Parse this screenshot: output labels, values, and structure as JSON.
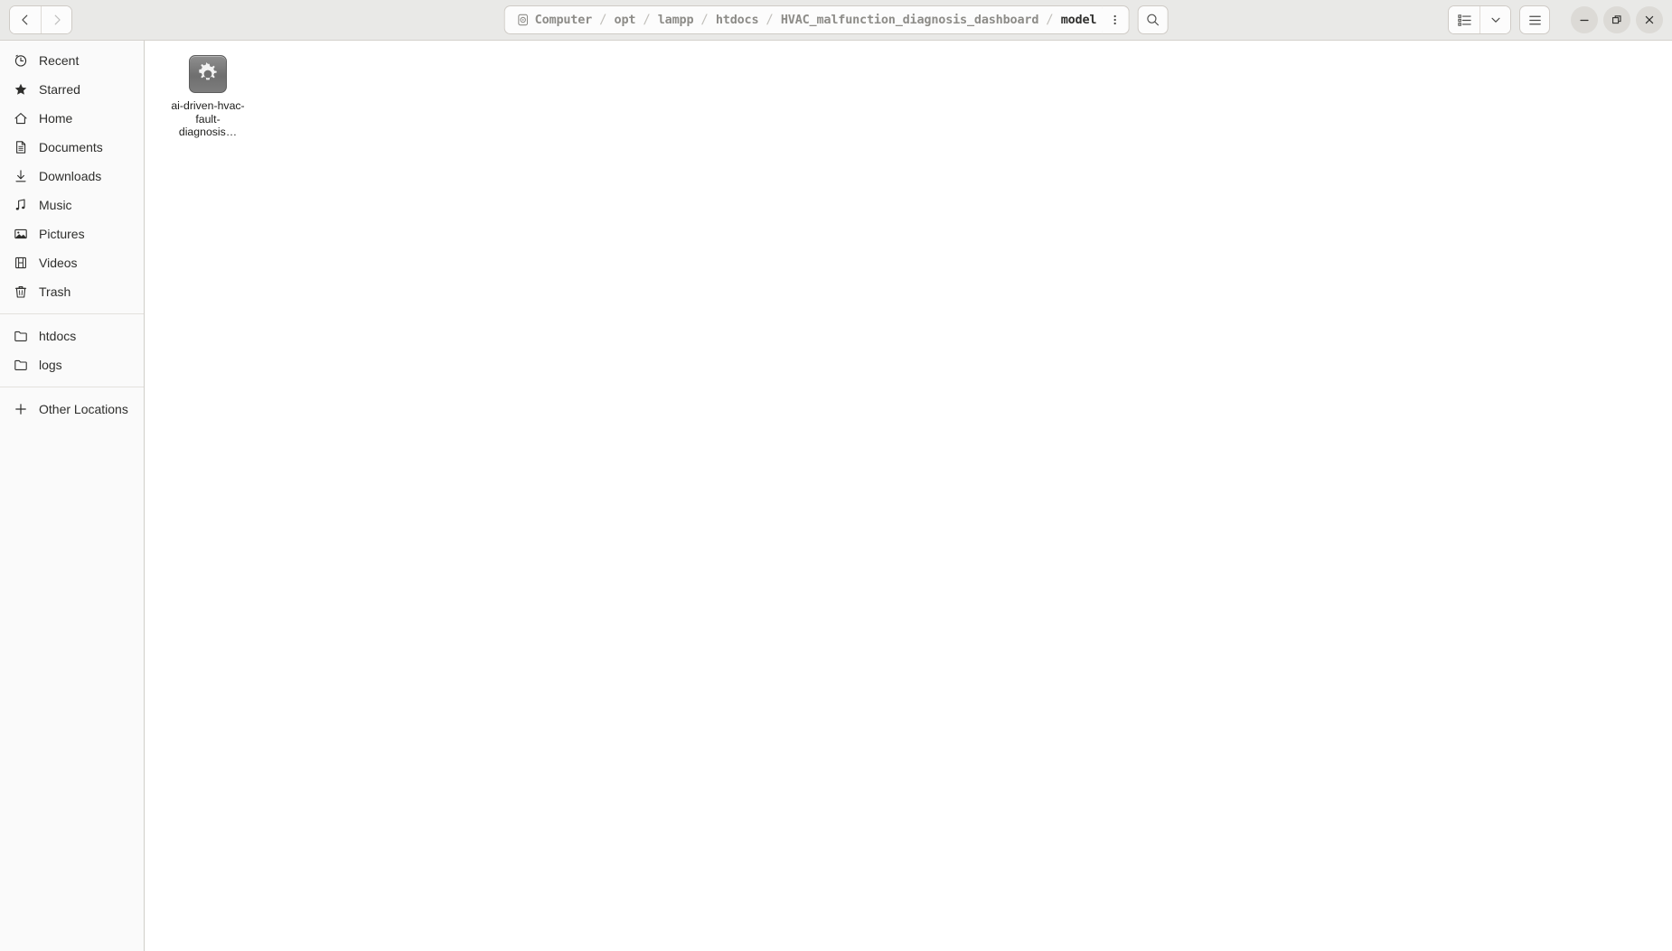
{
  "window": {
    "title": "model",
    "controls": {
      "minimize_label": "Minimize",
      "maximize_label": "Restore",
      "close_label": "Close"
    }
  },
  "toolbar": {
    "back_label": "Back",
    "forward_label": "Forward",
    "path_menu_label": "Path options",
    "search_label": "Search",
    "view_list_label": "List view",
    "view_dropdown_label": "View options",
    "hamburger_label": "Main menu"
  },
  "breadcrumb": {
    "drive_icon": "drive-icon",
    "separator": "/",
    "items": [
      {
        "label": "Computer",
        "current": false
      },
      {
        "label": "opt",
        "current": false
      },
      {
        "label": "lampp",
        "current": false
      },
      {
        "label": "htdocs",
        "current": false
      },
      {
        "label": "HVAC_malfunction_diagnosis_dashboard",
        "current": false
      },
      {
        "label": "model",
        "current": true
      }
    ]
  },
  "sidebar": {
    "groups": [
      {
        "items": [
          {
            "label": "Recent",
            "icon": "clock-icon"
          },
          {
            "label": "Starred",
            "icon": "star-icon"
          },
          {
            "label": "Home",
            "icon": "home-icon"
          },
          {
            "label": "Documents",
            "icon": "document-icon"
          },
          {
            "label": "Downloads",
            "icon": "download-icon"
          },
          {
            "label": "Music",
            "icon": "music-note-icon"
          },
          {
            "label": "Pictures",
            "icon": "image-icon"
          },
          {
            "label": "Videos",
            "icon": "film-icon"
          },
          {
            "label": "Trash",
            "icon": "trash-icon"
          }
        ]
      },
      {
        "items": [
          {
            "label": "htdocs",
            "icon": "folder-icon"
          },
          {
            "label": "logs",
            "icon": "folder-icon"
          }
        ]
      },
      {
        "items": [
          {
            "label": "Other Locations",
            "icon": "plus-icon"
          }
        ]
      }
    ]
  },
  "main": {
    "files": [
      {
        "name": "ai-driven-hvac-fault-diagnosis…",
        "icon": "gear-executable-icon",
        "selected": false
      }
    ]
  },
  "colors": {
    "headerbar_bg": "#e9e9e7",
    "sidebar_bg": "#fafafa",
    "content_bg": "#ffffff",
    "border": "#d0cec9",
    "text": "#2e2e2c",
    "breadcrumb_muted": "#8d8c88",
    "breadcrumb_current": "#2f2f2d",
    "file_icon_bg": "#777777"
  }
}
